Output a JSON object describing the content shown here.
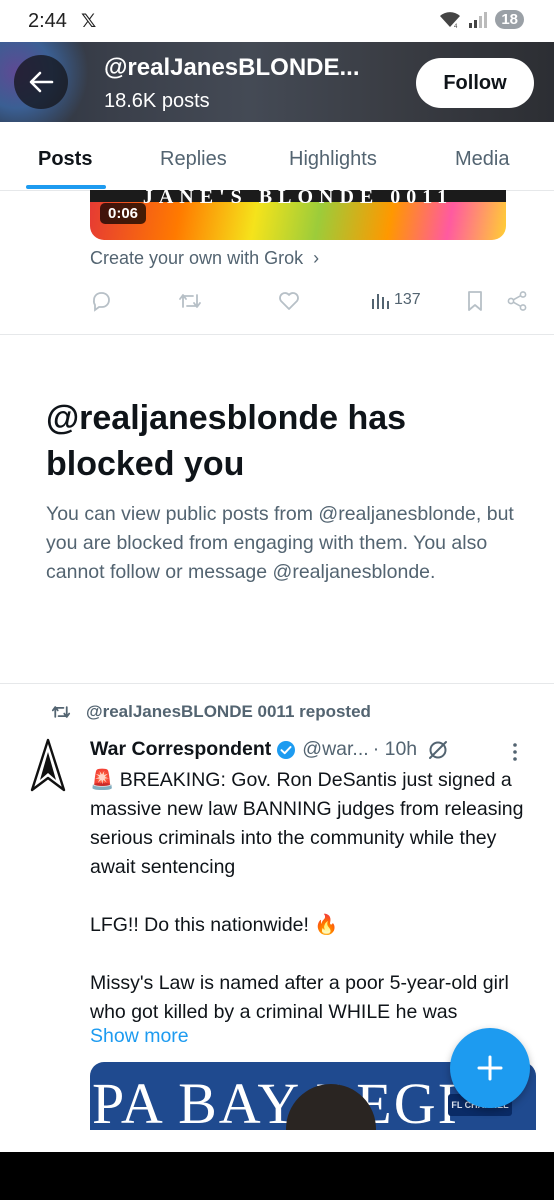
{
  "status_bar": {
    "time": "2:44",
    "app_glyph": "𝕏",
    "battery": "18"
  },
  "header": {
    "display_name": "@realJanesBLONDE...",
    "posts_count": "18.6K posts",
    "follow_label": "Follow"
  },
  "tabs": [
    {
      "label": "Posts",
      "active": true
    },
    {
      "label": "Replies",
      "active": false
    },
    {
      "label": "Highlights",
      "active": false
    },
    {
      "label": "Media",
      "active": false
    }
  ],
  "previous_post": {
    "video_duration": "0:06",
    "banner_text": "JANE'S BLONDE  0011",
    "grok_link": "Create your own with Grok",
    "views": "137"
  },
  "blocked_notice": {
    "title": "@realjanesblonde has blocked you",
    "body": "You can view public posts from @realjanesblonde, but you are blocked from engaging with them. You also cannot follow or message @realjanesblonde."
  },
  "repost": {
    "label": "@realJanesBLONDE 0011 reposted",
    "author_name": "War Correspondent",
    "author_handle": "@war...",
    "time": "· 10h",
    "text": "🚨 BREAKING: Gov. Ron DeSantis just signed a massive new law BANNING judges from releasing serious criminals into the community while they await sentencing\n\nLFG!! Do this nationwide! 🔥\n\nMissy's Law is named after a poor 5-year-old girl who got killed by a criminal WHILE he was",
    "show_more": "Show more",
    "image_text": "PA BAY REGI",
    "image_logo": "FL CHANNEL"
  },
  "colors": {
    "accent": "#1d9bf0",
    "text": "#0f1419",
    "muted": "#536471",
    "verified": "#1d9bf0"
  }
}
